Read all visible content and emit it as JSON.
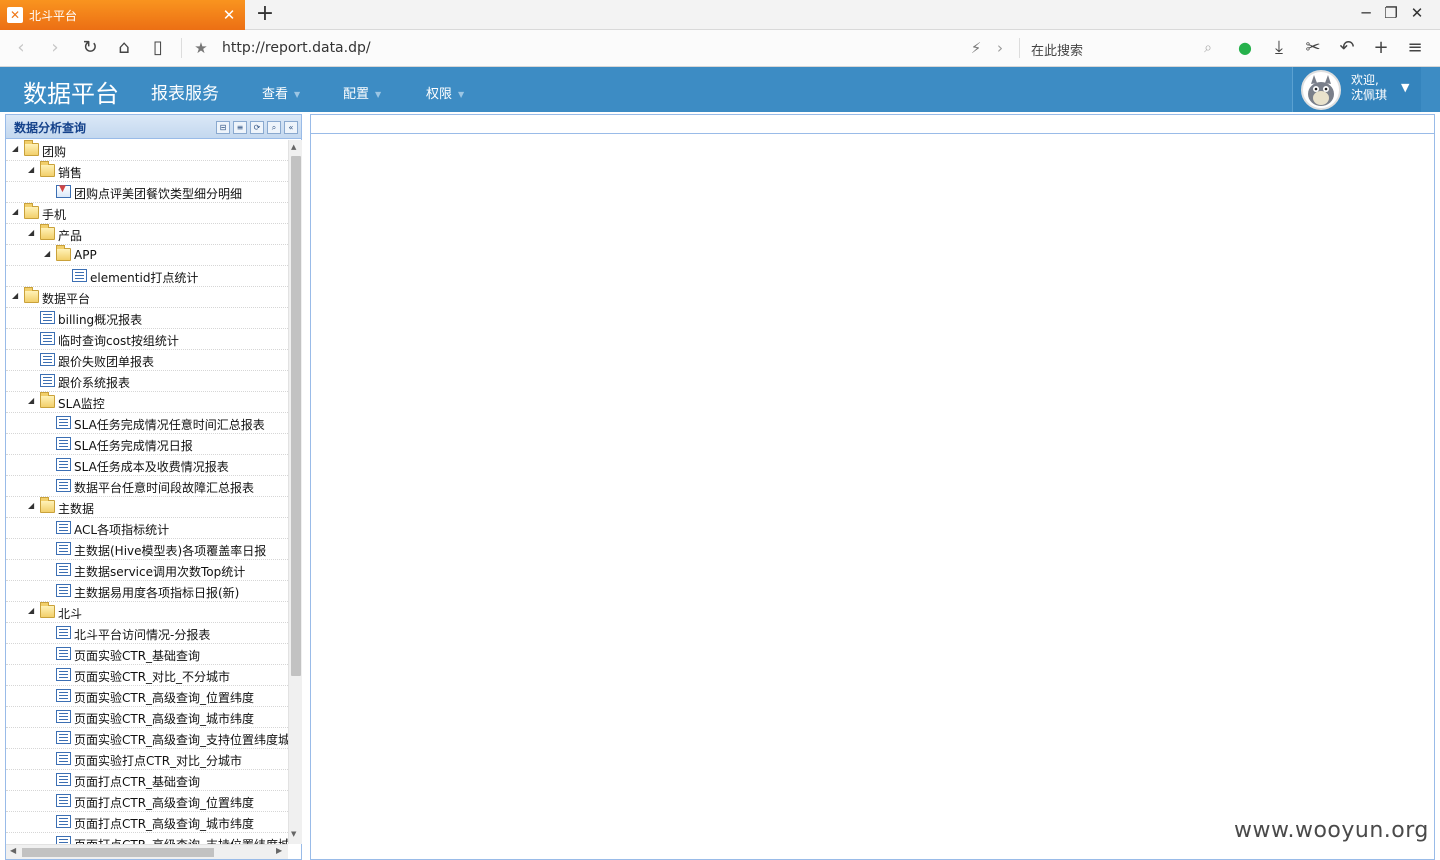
{
  "browser": {
    "tab_title": "北斗平台",
    "tab_favicon": "✕",
    "new_tab": "+",
    "url": "http://report.data.dp/",
    "search_placeholder": "在此搜索"
  },
  "app": {
    "brand": "数据平台",
    "subtitle": "报表服务",
    "menus": [
      "查看",
      "配置",
      "权限"
    ],
    "user_greeting": "欢迎,",
    "user_name": "沈佩琪",
    "header_color": "#3d8cc4"
  },
  "panel": {
    "title": "数据分析查询",
    "tree": [
      {
        "label": "团购",
        "type": "folder",
        "level": 0
      },
      {
        "label": "销售",
        "type": "folder",
        "level": 1
      },
      {
        "label": "团购点评美团餐饮类型细分明细",
        "type": "dl",
        "level": 2
      },
      {
        "label": "手机",
        "type": "folder",
        "level": 0
      },
      {
        "label": "产品",
        "type": "folder",
        "level": 1
      },
      {
        "label": "APP",
        "type": "folder",
        "level": 2
      },
      {
        "label": "elementid打点统计",
        "type": "report",
        "level": 3
      },
      {
        "label": "数据平台",
        "type": "folder",
        "level": 0
      },
      {
        "label": "billing概况报表",
        "type": "report",
        "level": 1
      },
      {
        "label": "临时查询cost按组统计",
        "type": "report",
        "level": 1
      },
      {
        "label": "跟价失败团单报表",
        "type": "report",
        "level": 1
      },
      {
        "label": "跟价系统报表",
        "type": "report",
        "level": 1
      },
      {
        "label": "SLA监控",
        "type": "folder",
        "level": 1
      },
      {
        "label": "SLA任务完成情况任意时间汇总报表",
        "type": "report",
        "level": 2
      },
      {
        "label": "SLA任务完成情况日报",
        "type": "report",
        "level": 2
      },
      {
        "label": "SLA任务成本及收费情况报表",
        "type": "report",
        "level": 2
      },
      {
        "label": "数据平台任意时间段故障汇总报表",
        "type": "report",
        "level": 2
      },
      {
        "label": "主数据",
        "type": "folder",
        "level": 1
      },
      {
        "label": "ACL各项指标统计",
        "type": "report",
        "level": 2
      },
      {
        "label": "主数据(Hive模型表)各项覆盖率日报",
        "type": "report",
        "level": 2
      },
      {
        "label": "主数据service调用次数Top统计",
        "type": "report",
        "level": 2
      },
      {
        "label": "主数据易用度各项指标日报(新)",
        "type": "report",
        "level": 2
      },
      {
        "label": "北斗",
        "type": "folder",
        "level": 1
      },
      {
        "label": "北斗平台访问情况-分报表",
        "type": "report",
        "level": 2
      },
      {
        "label": "页面实验CTR_基础查询",
        "type": "report",
        "level": 2
      },
      {
        "label": "页面实验CTR_对比_不分城市",
        "type": "report",
        "level": 2
      },
      {
        "label": "页面实验CTR_高级查询_位置纬度",
        "type": "report",
        "level": 2
      },
      {
        "label": "页面实验CTR_高级查询_城市纬度",
        "type": "report",
        "level": 2
      },
      {
        "label": "页面实验CTR_高级查询_支持位置纬度城",
        "type": "report",
        "level": 2
      },
      {
        "label": "页面实验打点CTR_对比_分城市",
        "type": "report",
        "level": 2
      },
      {
        "label": "页面打点CTR_基础查询",
        "type": "report",
        "level": 2
      },
      {
        "label": "页面打点CTR_高级查询_位置纬度",
        "type": "report",
        "level": 2
      },
      {
        "label": "页面打点CTR_高级查询_城市纬度",
        "type": "report",
        "level": 2
      },
      {
        "label": "页面打点CTR_高级查询_支持位置纬度城",
        "type": "report",
        "level": 2
      }
    ]
  },
  "watermark": "www.wooyun.org"
}
